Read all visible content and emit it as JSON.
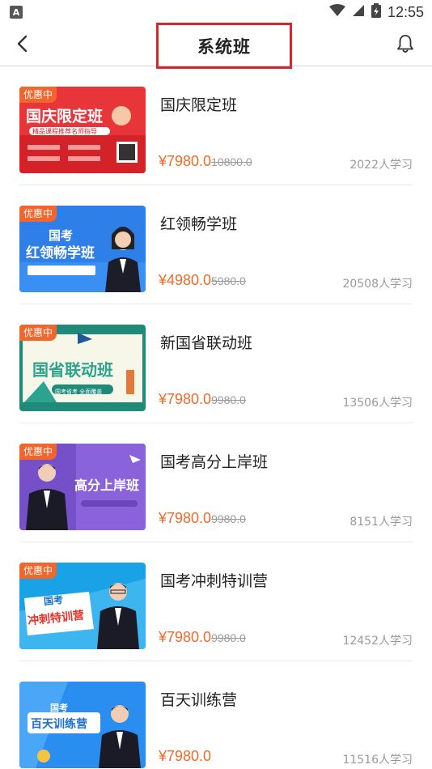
{
  "status_bar": {
    "time": "12:55",
    "app_icon_letter": "A"
  },
  "header": {
    "title": "系统班"
  },
  "badge_label": "优惠中",
  "courses": [
    {
      "title": "国庆限定班",
      "price": "¥7980.0",
      "original_price": "10800.0",
      "learners": "2022人学习",
      "thumb_title": "国庆限定班",
      "thumb_subtitle": "精品课程推荐名师指导",
      "thumb_caption": "",
      "theme": "red"
    },
    {
      "title": "红领畅学班",
      "price": "¥4980.0",
      "original_price": "5980.0",
      "learners": "20508人学习",
      "thumb_title": "红领畅学班",
      "thumb_subtitle": "国考",
      "thumb_caption": "",
      "theme": "blue"
    },
    {
      "title": "新国省联动班",
      "price": "¥7980.0",
      "original_price": "9980.0",
      "learners": "13506人学习",
      "thumb_title": "国省联动班",
      "thumb_subtitle": "国考省考 全面覆盖",
      "thumb_caption": "",
      "theme": "green"
    },
    {
      "title": "国考高分上岸班",
      "price": "¥7980.0",
      "original_price": "9980.0",
      "learners": "8151人学习",
      "thumb_title": "高分上岸班",
      "thumb_subtitle": "",
      "thumb_caption": "",
      "theme": "purple"
    },
    {
      "title": "国考冲刺特训营",
      "price": "¥7980.0",
      "original_price": "9980.0",
      "learners": "12452人学习",
      "thumb_title": "冲刺特训营",
      "thumb_subtitle": "国考",
      "thumb_caption": "",
      "theme": "cyan"
    },
    {
      "title": "百天训练营",
      "price": "¥7980.0",
      "original_price": "",
      "learners": "11516人学习",
      "thumb_title": "百天训练营",
      "thumb_subtitle": "国考",
      "thumb_caption": "",
      "theme": "lightblue"
    }
  ],
  "colors": {
    "accent_price": "#f06a2a",
    "badge": "#f0662c",
    "title_highlight": "#d9252b"
  }
}
